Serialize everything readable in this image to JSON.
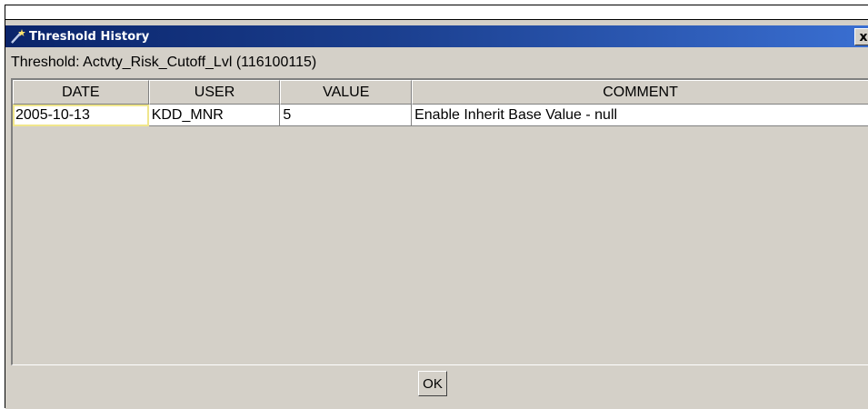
{
  "window": {
    "title": "Threshold History",
    "close_label": "x"
  },
  "threshold_label": "Threshold: Actvty_Risk_Cutoff_Lvl (116100115)",
  "table": {
    "columns": [
      "DATE",
      "USER",
      "VALUE",
      "COMMENT"
    ],
    "rows": [
      {
        "date": "2005-10-13",
        "user": "KDD_MNR",
        "value": "5",
        "comment": "Enable Inherit Base Value - null"
      }
    ]
  },
  "buttons": {
    "ok_label": "OK"
  },
  "colors": {
    "titlebar_start": "#0a246a",
    "titlebar_end": "#3a6fd2",
    "dialog_bg": "#d4d0c8",
    "focus_border": "#f0e68c"
  },
  "icons": {
    "title_icon": "wand-icon"
  }
}
